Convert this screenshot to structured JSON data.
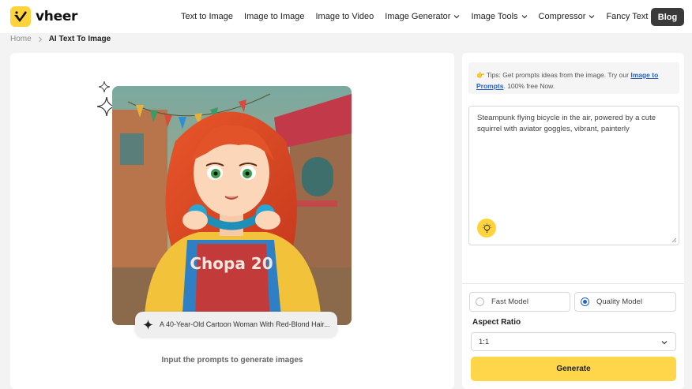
{
  "brand": {
    "name": "vheer",
    "accent": "#ffd43b"
  },
  "nav": {
    "items": [
      {
        "label": "Text to Image",
        "dropdown": false
      },
      {
        "label": "Image to Image",
        "dropdown": false
      },
      {
        "label": "Image to Video",
        "dropdown": false
      },
      {
        "label": "Image Generator",
        "dropdown": true
      },
      {
        "label": "Image Tools",
        "dropdown": true
      },
      {
        "label": "Compressor",
        "dropdown": true
      },
      {
        "label": "Fancy Text",
        "dropdown": true
      }
    ],
    "blog_label": "Blog"
  },
  "breadcrumb": {
    "home": "Home",
    "current": "AI Text To Image"
  },
  "preview": {
    "caption": "A 40-Year-Old Cartoon Woman With Red-Blond Hair...",
    "shirt_text": "Chopa 20",
    "hint": "Input the prompts to generate images"
  },
  "tips": {
    "prefix": "Tips: Get prompts ideas from the image. Try our",
    "link": "Image to Prompts",
    "suffix": ". 100% free Now."
  },
  "prompt": {
    "value": "Steampunk flying bicycle in the air, powered by a cute squirrel with aviator goggles, vibrant, painterly"
  },
  "models": {
    "fast": "Fast Model",
    "quality": "Quality Model",
    "selected": "quality"
  },
  "aspect_ratio": {
    "label": "Aspect Ratio",
    "value": "1:1"
  },
  "generate_label": "Generate"
}
